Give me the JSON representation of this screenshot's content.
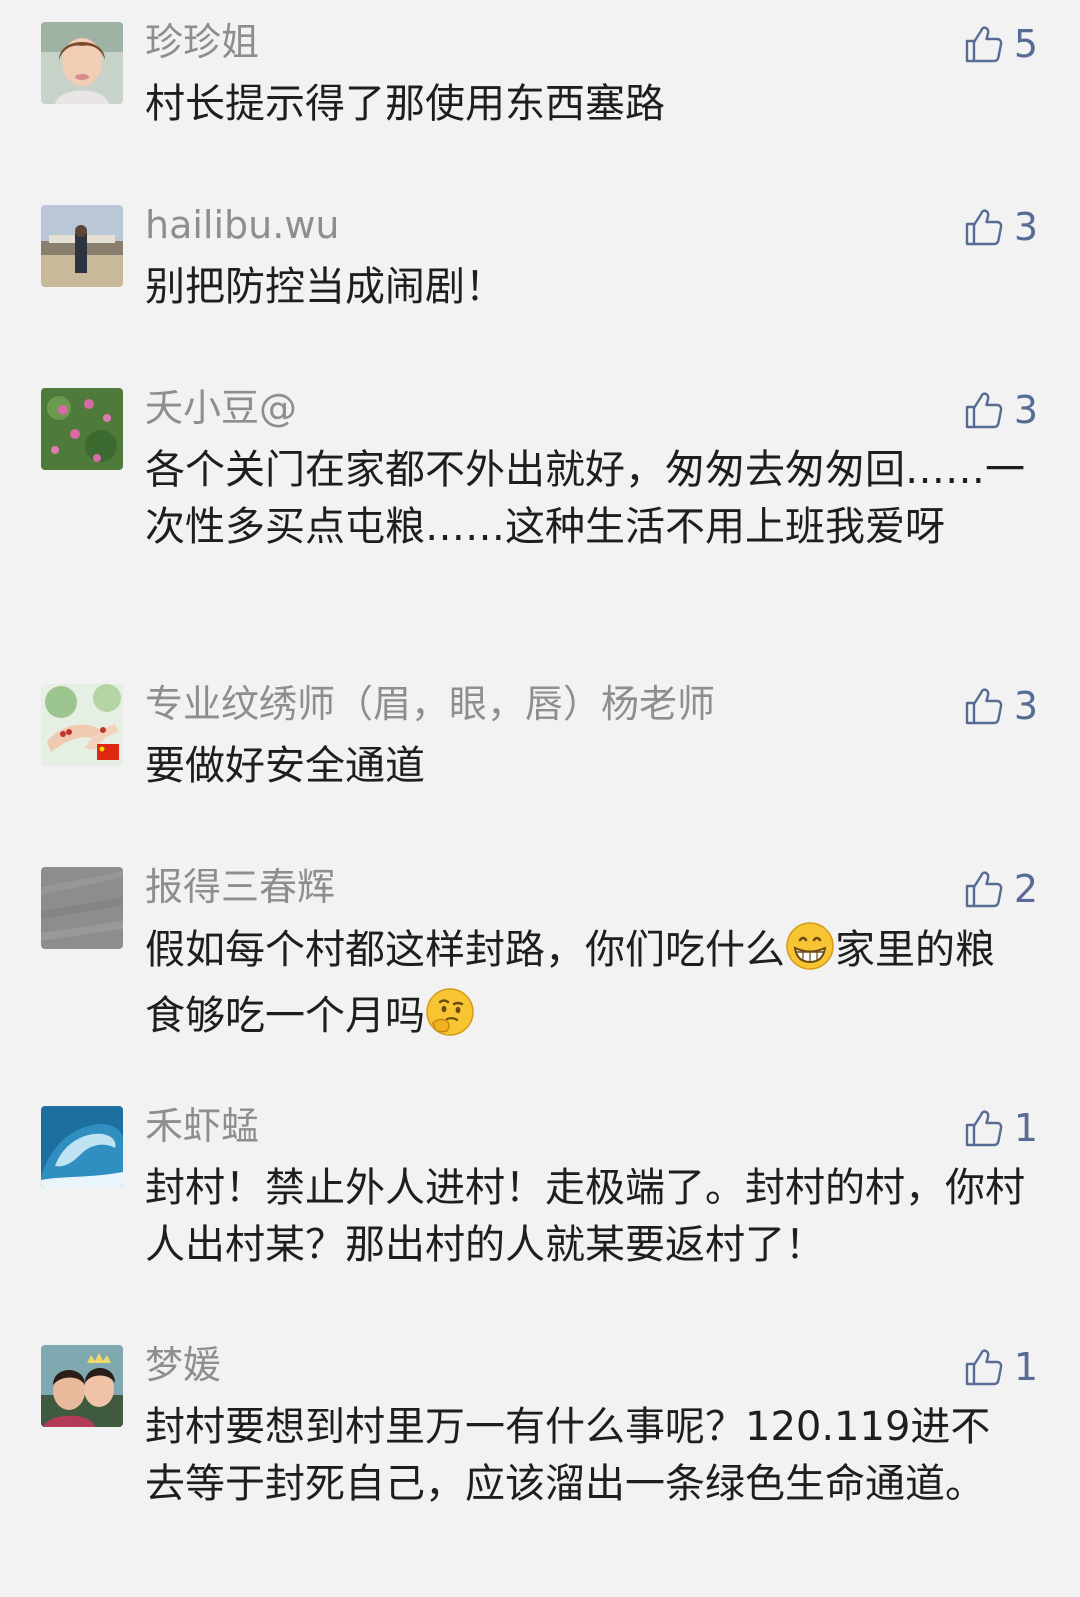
{
  "comments": [
    {
      "name": "珍珍姐",
      "text": "村长提示得了那使用东西塞路",
      "likes": "5"
    },
    {
      "name": "hailibu.wu",
      "text": "别把防控当成闹剧！",
      "likes": "3"
    },
    {
      "name": "夭小豆@",
      "text": "各个关门在家都不外出就好，匆匆去匆匆回……一次性多买点屯粮……这种生活不用上班我爱呀",
      "likes": "3"
    },
    {
      "name": "专业纹绣师（眉，眼，唇）杨老师",
      "text": "要做好安全通道",
      "likes": "3"
    },
    {
      "name": "报得三春辉",
      "text_a": "假如每个村都这样封路，你们吃什么",
      "text_b": "家里的粮食够吃一个月吗",
      "emoji_1": "grinning-face-emoji",
      "emoji_2": "thinking-face-emoji",
      "likes": "2"
    },
    {
      "name": "禾虾蜢",
      "text": "封村！禁止外人进村！走极端了。封村的村，你村人出村某？那出村的人就某要返村了！",
      "likes": "1"
    },
    {
      "name": "梦媛",
      "text": "封村要想到村里万一有什么事呢？120.119进不去等于封死自己，应该溜出一条绿色生命通道。",
      "likes": "1"
    }
  ],
  "colors": {
    "background": "#f2f2f2",
    "name": "#8e8e8e",
    "text": "#1e1e1e",
    "like": "#586b95"
  },
  "icons": {
    "like": "thumbs-up-outline-icon",
    "flag": "china-flag-icon"
  }
}
